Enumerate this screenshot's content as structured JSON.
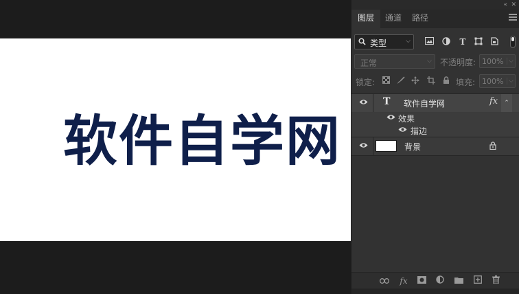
{
  "canvas": {
    "text": "软件自学网",
    "text_color": "#0f1f4a",
    "background": "#ffffff"
  },
  "panel": {
    "topbar": {
      "collapse_icon": "double-chevron-left-icon",
      "close_icon": "close-icon",
      "collapse_glyph": "«",
      "close_glyph": "✕"
    },
    "tabs": [
      {
        "label": "图层",
        "active": true
      },
      {
        "label": "通道",
        "active": false
      },
      {
        "label": "路径",
        "active": false
      }
    ],
    "filter": {
      "kind": "类型",
      "icons": [
        "image-filter-icon",
        "adjustment-filter-icon",
        "type-filter-icon",
        "shape-filter-icon",
        "smart-object-filter-icon"
      ]
    },
    "blend": {
      "mode": "正常",
      "opacity_label": "不透明度:",
      "opacity_value": "100%"
    },
    "lock": {
      "label": "锁定:",
      "icons": [
        "lock-transparent-icon",
        "lock-image-icon",
        "lock-position-icon",
        "lock-artboard-icon",
        "lock-all-icon"
      ],
      "fill_label": "填充:",
      "fill_value": "100%"
    },
    "layers": [
      {
        "name": "软件自学网",
        "type_glyph": "T",
        "fx_label": "fx",
        "selected": true
      },
      {
        "name": "效果"
      },
      {
        "name": "描边"
      },
      {
        "name": "背景",
        "locked": true
      }
    ],
    "bottom_icons": [
      "link-layers-icon",
      "fx-icon",
      "add-mask-icon",
      "adjustment-layer-icon",
      "group-folder-icon",
      "new-layer-icon",
      "trash-icon"
    ],
    "bottom_fx_label": "fx"
  },
  "colors": {
    "panel_bg": "#323232",
    "selected_layer": "#444444",
    "canvas_backdrop": "#1c1c1c"
  }
}
